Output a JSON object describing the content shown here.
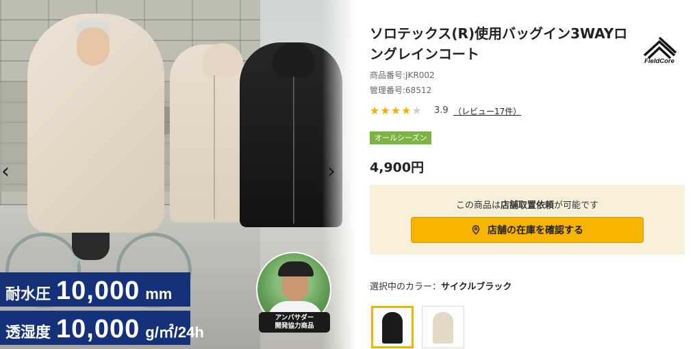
{
  "hero": {
    "badges": [
      {
        "label": "耐水圧",
        "value": "10,000",
        "unit": "mm"
      },
      {
        "label": "透湿度",
        "value": "10,000",
        "unit": "g/㎡/24h"
      }
    ],
    "ambassador_label": "アンバサダー\n開発協力商品",
    "nav": {
      "prev": "‹",
      "next": "›"
    }
  },
  "product": {
    "title": "ソロテックス(R)使用バッグイン3WAYロングレインコート",
    "brand": "FieldCore",
    "product_number": "商品番号:JKR002",
    "management_number": "管理番号:68512",
    "rating_value": "3.9",
    "rating_stars": 4,
    "rating_max": 5,
    "review_link": "（レビュー17件）",
    "season_tag": "オールシーズン",
    "price": "4,900円"
  },
  "store": {
    "message_prefix": "この商品は",
    "message_bold": "店舗取置依頼",
    "message_suffix": "が可能です",
    "button_label": "店舗の在庫を確認する"
  },
  "color": {
    "label_prefix": "選択中のカラー：",
    "selected": "サイクルブラック"
  },
  "colors": {
    "accent": "#f6b400",
    "navy": "#14317a",
    "season_green": "#7cb342",
    "swatch_black": "#1a1a1a",
    "swatch_beige": "#e4d8c6"
  }
}
